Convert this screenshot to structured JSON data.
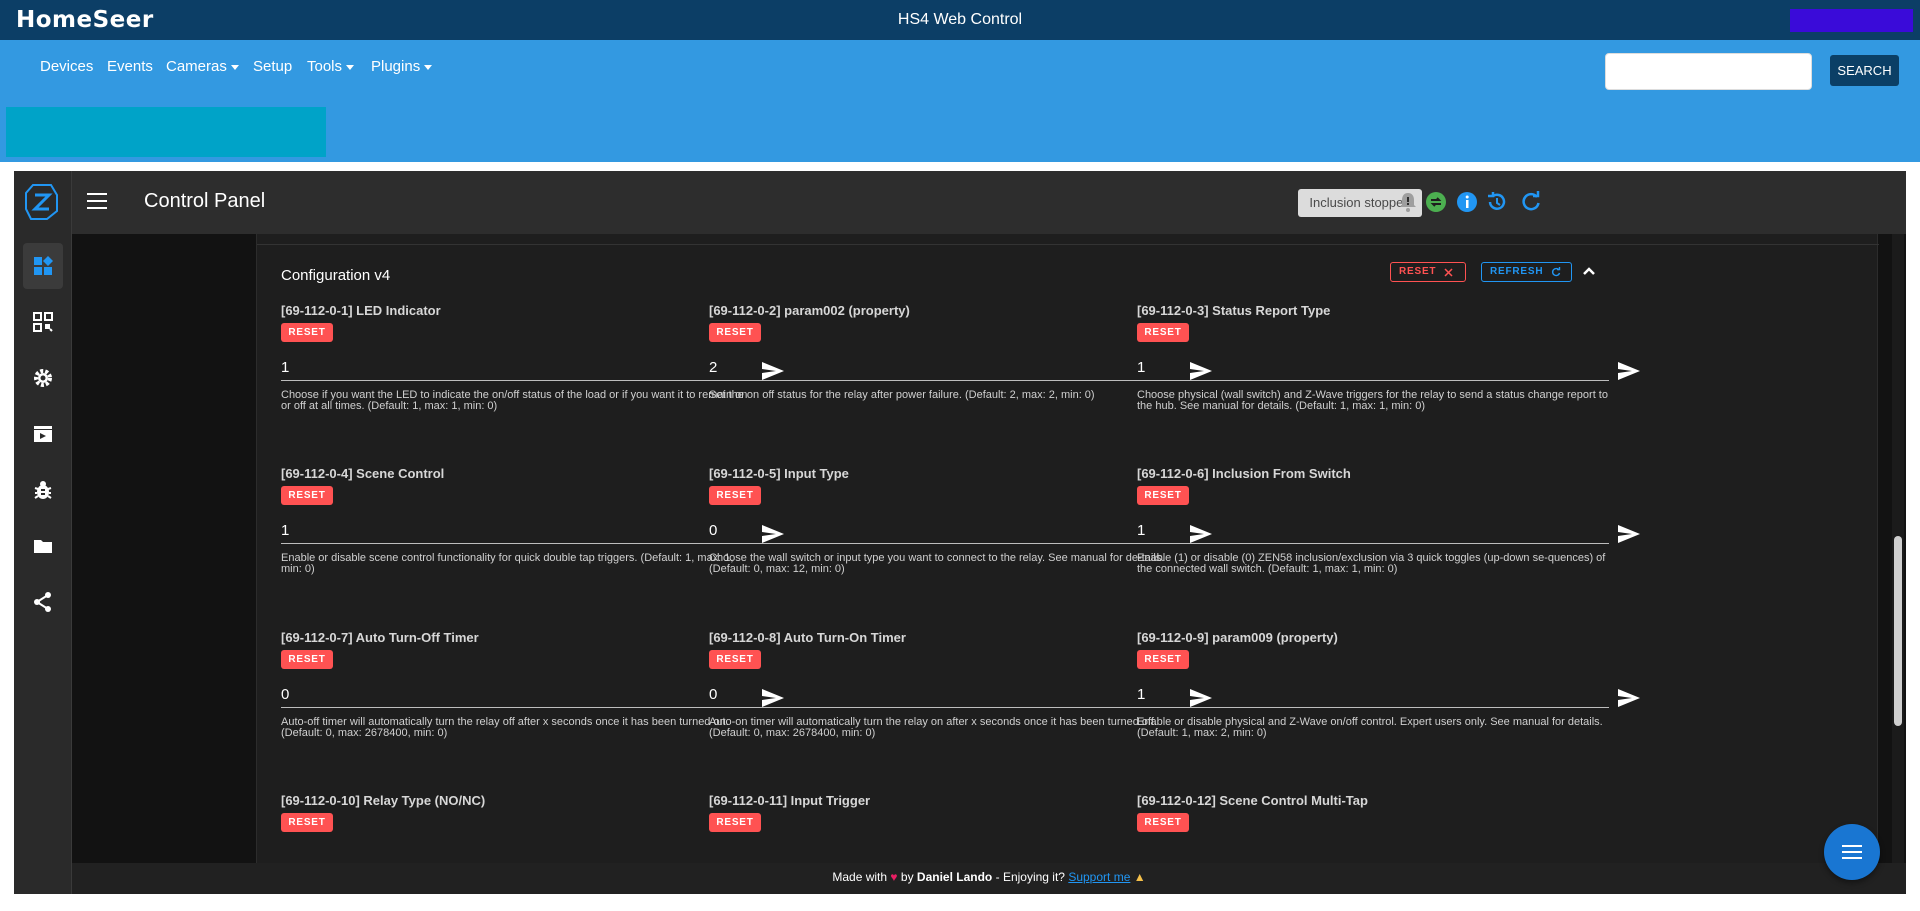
{
  "homeseer": {
    "logo": "HomeSeer",
    "title": "HS4 Web Control",
    "nav": [
      {
        "label": "Devices",
        "dropdown": false
      },
      {
        "label": "Events",
        "dropdown": false
      },
      {
        "label": "Cameras",
        "dropdown": true
      },
      {
        "label": "Setup",
        "dropdown": false
      },
      {
        "label": "Tools",
        "dropdown": true
      },
      {
        "label": "Plugins",
        "dropdown": true
      }
    ],
    "search": {
      "placeholder": "",
      "value": "",
      "button": "SEARCH"
    }
  },
  "zwave": {
    "title": "Control Panel",
    "inclusion_status": "Inclusion stopped",
    "sidebar_icons": [
      "control-panel-icon",
      "smart-start-icon",
      "settings-icon",
      "scenes-icon",
      "debug-icon",
      "store-icon",
      "mesh-icon"
    ],
    "appbar_icons": [
      "notifications-icon",
      "network-status-icon",
      "info-icon",
      "history-icon",
      "refresh-icon"
    ],
    "section": {
      "title": "Configuration v4",
      "reset_label": "RESET",
      "refresh_label": "REFRESH"
    },
    "params": [
      {
        "title": "[69-112-0-1] LED Indicator",
        "reset": "RESET",
        "value": "1",
        "help": "Choose if you want the LED to indicate the on/off status of the load or if you want it to remain on or off at all times. (Default: 1, max: 1, min: 0)"
      },
      {
        "title": "[69-112-0-2] param002 (property)",
        "reset": "RESET",
        "value": "2",
        "help": "Set the on off status for the relay after power failure. (Default: 2, max: 2, min: 0)"
      },
      {
        "title": "[69-112-0-3] Status Report Type",
        "reset": "RESET",
        "value": "1",
        "help": "Choose physical (wall switch) and Z-Wave triggers for the relay to send a status change report to the hub. See manual for details. (Default: 1, max: 1, min: 0)"
      },
      {
        "title": "[69-112-0-4] Scene Control",
        "reset": "RESET",
        "value": "1",
        "help": "Enable or disable scene control functionality for quick double tap triggers. (Default: 1, max: 1, min: 0)"
      },
      {
        "title": "[69-112-0-5] Input Type",
        "reset": "RESET",
        "value": "0",
        "help": "Choose the wall switch or input type you want to connect to the relay. See manual for de-tails. (Default: 0, max: 12, min: 0)"
      },
      {
        "title": "[69-112-0-6] Inclusion From Switch",
        "reset": "RESET",
        "value": "1",
        "help": "Enable (1) or disable (0) ZEN58 inclusion/exclusion via 3 quick toggles (up-down se-quences) of the connected wall switch. (Default: 1, max: 1, min: 0)"
      },
      {
        "title": "[69-112-0-7] Auto Turn-Off Timer",
        "reset": "RESET",
        "value": "0",
        "help": "Auto-off timer will automatically turn the relay off after x seconds once it has been turned on. (Default: 0, max: 2678400, min: 0)"
      },
      {
        "title": "[69-112-0-8] Auto Turn-On Timer",
        "reset": "RESET",
        "value": "0",
        "help": "Auto-on timer will automatically turn the relay on after x seconds once it has been turned off. (Default: 0, max: 2678400, min: 0)"
      },
      {
        "title": "[69-112-0-9] param009 (property)",
        "reset": "RESET",
        "value": "1",
        "help": "Enable or disable physical and Z-Wave on/off control. Expert users only. See manual for details. (Default: 1, max: 2, min: 0)"
      },
      {
        "title": "[69-112-0-10] Relay Type (NO/NC)",
        "reset": "RESET",
        "value": "",
        "help": ""
      },
      {
        "title": "[69-112-0-11] Input Trigger",
        "reset": "RESET",
        "value": "",
        "help": ""
      },
      {
        "title": "[69-112-0-12] Scene Control Multi-Tap",
        "reset": "RESET",
        "value": "",
        "help": ""
      }
    ],
    "footer": {
      "made_with": "Made with",
      "by": "by",
      "author": "Daniel Lando",
      "enjoying": "- Enjoying it?",
      "support": "Support me"
    }
  }
}
